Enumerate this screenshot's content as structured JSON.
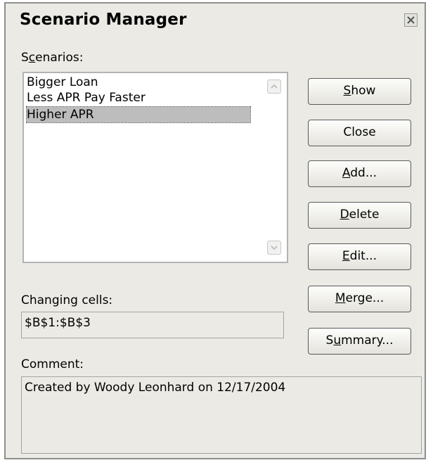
{
  "dialog": {
    "title": "Scenario Manager"
  },
  "scenarios": {
    "label_pre": "S",
    "label_acc": "c",
    "label_post": "enarios:",
    "items": [
      {
        "label": "Bigger Loan"
      },
      {
        "label": "Less APR Pay Faster"
      },
      {
        "label": "Higher APR"
      }
    ],
    "selected_index": 2
  },
  "changing_cells": {
    "label": "Changing cells:",
    "value": "$B$1:$B$3"
  },
  "comment": {
    "label": "Comment:",
    "value": "Created by Woody Leonhard on 12/17/2004"
  },
  "buttons": {
    "show": {
      "pre": "",
      "acc": "S",
      "post": "how"
    },
    "close": {
      "pre": "Close",
      "acc": "",
      "post": ""
    },
    "add": {
      "pre": "",
      "acc": "A",
      "post": "dd..."
    },
    "delete": {
      "pre": "",
      "acc": "D",
      "post": "elete"
    },
    "edit": {
      "pre": "",
      "acc": "E",
      "post": "dit..."
    },
    "merge": {
      "pre": "",
      "acc": "M",
      "post": "erge..."
    },
    "summary": {
      "pre": "S",
      "acc": "u",
      "post": "mmary..."
    }
  }
}
